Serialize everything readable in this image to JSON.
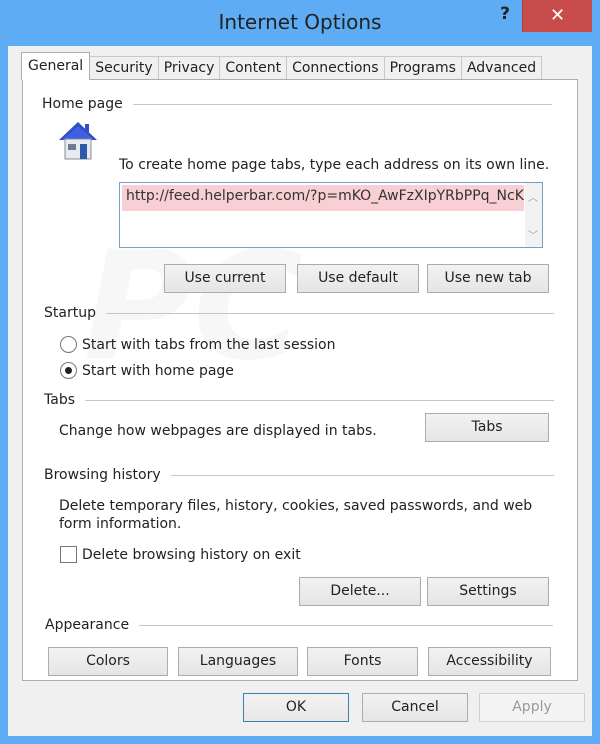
{
  "window": {
    "title": "Internet Options",
    "help_label": "?",
    "close_label": "✕"
  },
  "tabs": [
    {
      "label": "General",
      "active": true
    },
    {
      "label": "Security",
      "active": false
    },
    {
      "label": "Privacy",
      "active": false
    },
    {
      "label": "Content",
      "active": false
    },
    {
      "label": "Connections",
      "active": false
    },
    {
      "label": "Programs",
      "active": false
    },
    {
      "label": "Advanced",
      "active": false
    }
  ],
  "home_page": {
    "legend": "Home page",
    "icon": "house-icon",
    "instruction": "To create home page tabs, type each address on its own line.",
    "url_value": "http://feed.helperbar.com/?p=mKO_AwFzXIpYRbPPq_NcKD",
    "buttons": {
      "use_current": "Use current",
      "use_default": "Use default",
      "use_new_tab": "Use new tab"
    }
  },
  "startup": {
    "legend": "Startup",
    "options": [
      {
        "label": "Start with tabs from the last session",
        "selected": false
      },
      {
        "label": "Start with home page",
        "selected": true
      }
    ]
  },
  "tabs_section": {
    "legend": "Tabs",
    "description": "Change how webpages are displayed in tabs.",
    "button": "Tabs"
  },
  "browsing_history": {
    "legend": "Browsing history",
    "description_line1": "Delete temporary files, history, cookies, saved passwords, and web",
    "description_line2": "form information.",
    "checkbox_label": "Delete browsing history on exit",
    "checkbox_checked": false,
    "delete_button": "Delete...",
    "settings_button": "Settings"
  },
  "appearance": {
    "legend": "Appearance",
    "buttons": {
      "colors": "Colors",
      "languages": "Languages",
      "fonts": "Fonts",
      "accessibility": "Accessibility"
    }
  },
  "footer": {
    "ok": "OK",
    "cancel": "Cancel",
    "apply": "Apply"
  },
  "colors": {
    "frame": "#5eacf3",
    "close": "#c84c4c",
    "url_highlight": "#f8cfd2"
  }
}
